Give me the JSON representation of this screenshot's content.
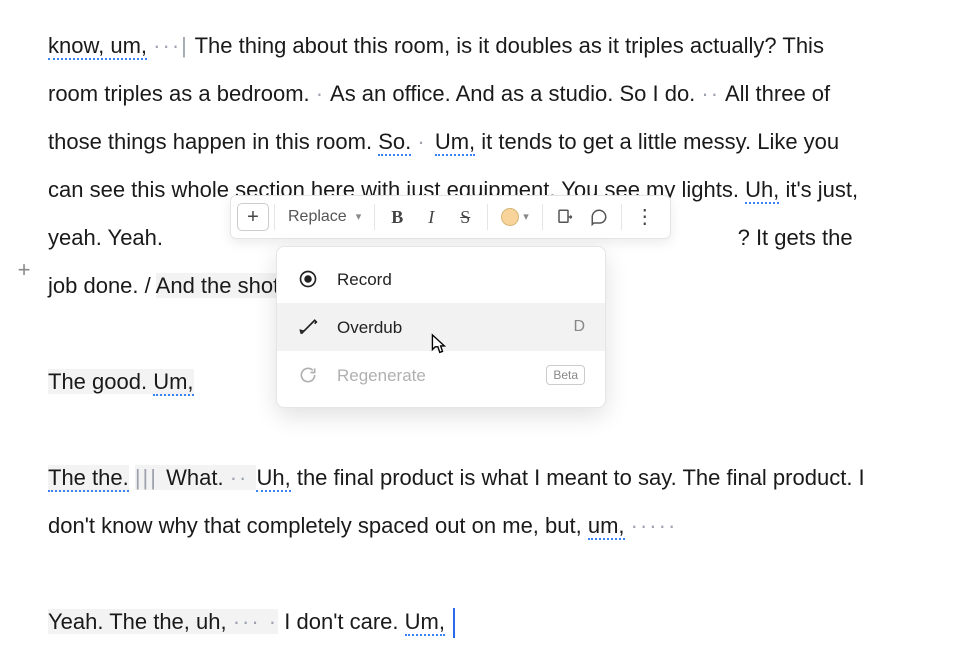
{
  "toolbar": {
    "replace_label": "Replace",
    "bold": "B",
    "italic": "I",
    "strike": "S",
    "highlight_color": "#f8d49a"
  },
  "menu": {
    "record": "Record",
    "overdub": "Overdub",
    "overdub_key": "D",
    "regenerate": "Regenerate",
    "regenerate_badge": "Beta"
  },
  "transcript": {
    "p1_a": "know, um,",
    "p1_gap1": "···|",
    "p1_b": " The thing about this room, is it doubles as it triples actually? This room triples as a bedroom. ",
    "p1_gap2": "·",
    "p1_c": " As an office. And as a studio. So I do. ",
    "p1_gap3": "··",
    "p1_d": " All three of those things happen in this room. ",
    "p1_so": "So.",
    "p1_gap4": " · ",
    "p1_um": "Um,",
    "p1_e": " it tends to get a little messy. Like you can see this whole section here with just equipment. You see my lights. ",
    "p1_uh": "Uh,",
    "p1_f": " it's just, yeah. Yeah. ",
    "p1_hidden": "                                                                                            ",
    "p1_g": "? It gets the job done. / ",
    "p1_sel": "And the shots",
    "p2_sel1": "The good. ",
    "p2_um": "Um,",
    "p3_sel1": "The the.",
    "p3_gap1": " ||| ",
    "p3_sel2": "What. ",
    "p3_gap2": "·· ",
    "p3_uh": "Uh,",
    "p3_a": " the final product is what I meant to say. The final product. I don't know why that completely spaced out on me, but, ",
    "p3_um": "um,",
    "p3_gap3": "  ·····",
    "p4_sel": "Yeah. The the, uh, ",
    "p4_gap": "··· ·",
    "p4_a": "I don't care. ",
    "p4_um": "Um,"
  }
}
